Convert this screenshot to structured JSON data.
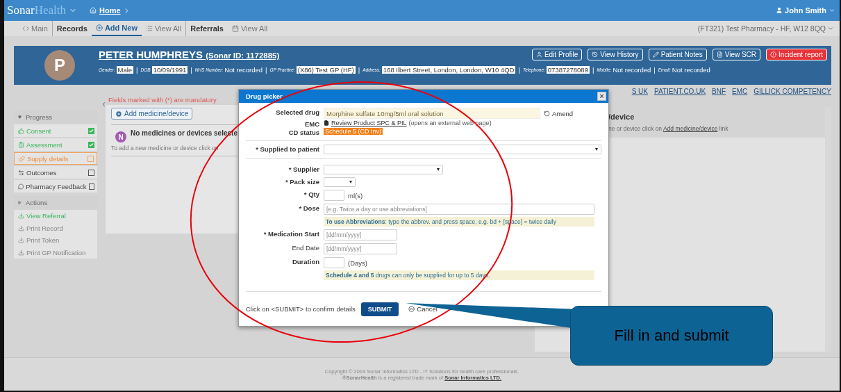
{
  "topbar": {
    "brand_main": "Sonar",
    "brand_accent": "Health",
    "breadcrumb": "Home",
    "user": "John Smith"
  },
  "nav": {
    "items": [
      {
        "label": "Main",
        "kind": "link",
        "selected": false
      },
      {
        "label": "Records",
        "kind": "section",
        "selected": false
      },
      {
        "label": "Add New",
        "kind": "link",
        "selected": true
      },
      {
        "label": "View All",
        "kind": "link",
        "selected": false
      },
      {
        "label": "Referrals",
        "kind": "section",
        "selected": false
      },
      {
        "label": "View All",
        "kind": "link",
        "selected": false
      }
    ],
    "pharmacy": "(FT321) Test Pharmacy - HF, W12 8QQ"
  },
  "patient": {
    "initial": "P",
    "name": "PETER HUMPHREYS",
    "sonar_id": "(Sonar ID: 1172885)",
    "buttons": [
      {
        "label": "Edit Profile",
        "kind": "default"
      },
      {
        "label": "View History",
        "kind": "default"
      },
      {
        "label": "Patient Notes",
        "kind": "default"
      },
      {
        "label": "View SCR",
        "kind": "default"
      },
      {
        "label": "Incident report",
        "kind": "danger"
      }
    ],
    "separator": "|",
    "details": [
      {
        "label": "Gender:",
        "value": "Male",
        "boxed": true
      },
      {
        "label": "DOB",
        "value": "10/09/1991",
        "boxed": true
      },
      {
        "label": "NHS Number:",
        "value": "Not recorded",
        "boxed": false
      },
      {
        "label": "GP Practice:",
        "value": "(X86) Test GP (HF)",
        "boxed": true
      },
      {
        "label": "Address:",
        "value": "168 Ilbert Street, London, London, W10 4QD",
        "boxed": true
      },
      {
        "label": "Telephone:",
        "value": "07387278089",
        "boxed": true
      },
      {
        "label": "Mobile:",
        "value": "Not recorded",
        "boxed": false
      },
      {
        "label": "Email:",
        "value": "Not recorded",
        "boxed": false
      }
    ]
  },
  "sidebar": {
    "collapse": "‹",
    "groups": [
      {
        "title": "Progress",
        "expanded": true,
        "items": [
          {
            "label": "Consent",
            "kind": "done",
            "checked": true
          },
          {
            "label": "Assessment",
            "kind": "done",
            "checked": true
          },
          {
            "label": "Supply details",
            "kind": "current",
            "checked": false
          },
          {
            "label": "Outcomes",
            "kind": "todo",
            "checked": false
          },
          {
            "label": "Pharmacy Feedback",
            "kind": "todo",
            "checked": false
          }
        ]
      },
      {
        "title": "Actions",
        "expanded": false,
        "items": [
          {
            "label": "View Referral",
            "disabled": false
          },
          {
            "label": "Print Record",
            "disabled": true
          },
          {
            "label": "Print Token",
            "disabled": true
          },
          {
            "label": "Print GP Notification",
            "disabled": true
          }
        ]
      }
    ]
  },
  "main": {
    "mandatory_note": "Fields marked with (*) are mandatory",
    "add_button": "Add medicine/device",
    "empty": {
      "initial": "N",
      "title": "No medicines or devices selecte",
      "text": "To add a new medicine or device click on"
    }
  },
  "right_panel": {
    "links": [
      "S UK",
      "PATIENT.CO.UK",
      "BNF",
      "EMC",
      "GILLICK COMPETENCY"
    ],
    "heading": "/device",
    "text_before": "ne or device click on",
    "link": "Add medicine/device",
    "text_after": "link"
  },
  "modal": {
    "title": "Drug picker",
    "close": "×",
    "selected_drug": {
      "label": "Selected drug",
      "value": "Morphine sulfate 10mg/5ml oral solution",
      "action": "Amend"
    },
    "emc": {
      "label": "EMC",
      "link": "Review Product SPC & PIL",
      "note": "(opens an external web page)"
    },
    "cd_status": {
      "label": "CD status",
      "badge": "Schedule 5 (CD Inv)"
    },
    "patient_field": {
      "label": "* Supplied to patient",
      "kind": "select"
    },
    "fields": [
      {
        "label": "* Supplier",
        "kind": "select"
      },
      {
        "label": "* Pack size",
        "kind": "select"
      },
      {
        "label": "* Qty",
        "kind": "number",
        "unit": "ml(s)"
      },
      {
        "label": "* Dose",
        "kind": "text",
        "placeholder": "[e.g. Twice a day or use abbreviations]"
      },
      {
        "kind": "hint",
        "text": "**To use Abbreviations**: type the abbrev. and press space, e.g. bd + [space] = twice daily"
      },
      {
        "label": "* Medication Start",
        "kind": "date",
        "placeholder": "[dd/mm/yyyy]",
        "bold": true
      },
      {
        "label": "End Date",
        "kind": "date",
        "placeholder": "[dd/mm/yyyy]",
        "bold": false
      },
      {
        "label": "Duration",
        "kind": "number",
        "unit": "(Days)"
      },
      {
        "kind": "hint",
        "text": "**Schedule 4 and 5** drugs can only be supplied for up to 5 days."
      }
    ],
    "footer": {
      "instruction": "Click on <SUBMIT> to confirm details",
      "submit": "SUBMIT",
      "cancel": "Cancel"
    }
  },
  "footer": {
    "copyright": "Copyright © 2019 Sonar Informatics LTD - IT Solutions for health care professionals.",
    "trademark": "**®SonarHealth** is a registered trade mark of ",
    "trademark_link": "Sonar Informatics LTD."
  },
  "callout": {
    "text": "Fill in and submit"
  }
}
